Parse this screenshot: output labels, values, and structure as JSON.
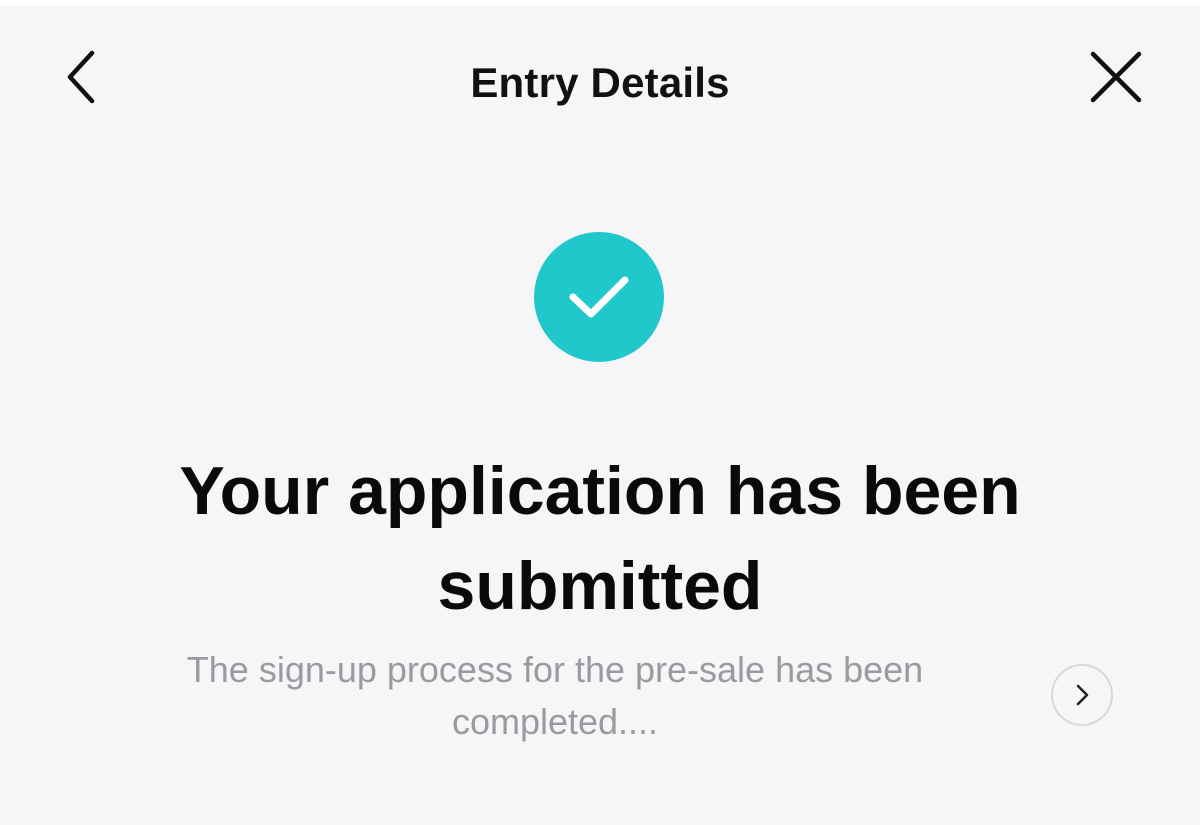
{
  "header": {
    "title": "Entry Details",
    "back_icon": "chevron-left-icon",
    "close_icon": "close-icon"
  },
  "status": {
    "icon": "checkmark-icon",
    "accent_color": "#20c8cc",
    "headline": "Your application has been submitted",
    "description": "The sign-up process for the pre-sale has been completed...."
  },
  "details_link": {
    "icon": "chevron-right-icon"
  }
}
